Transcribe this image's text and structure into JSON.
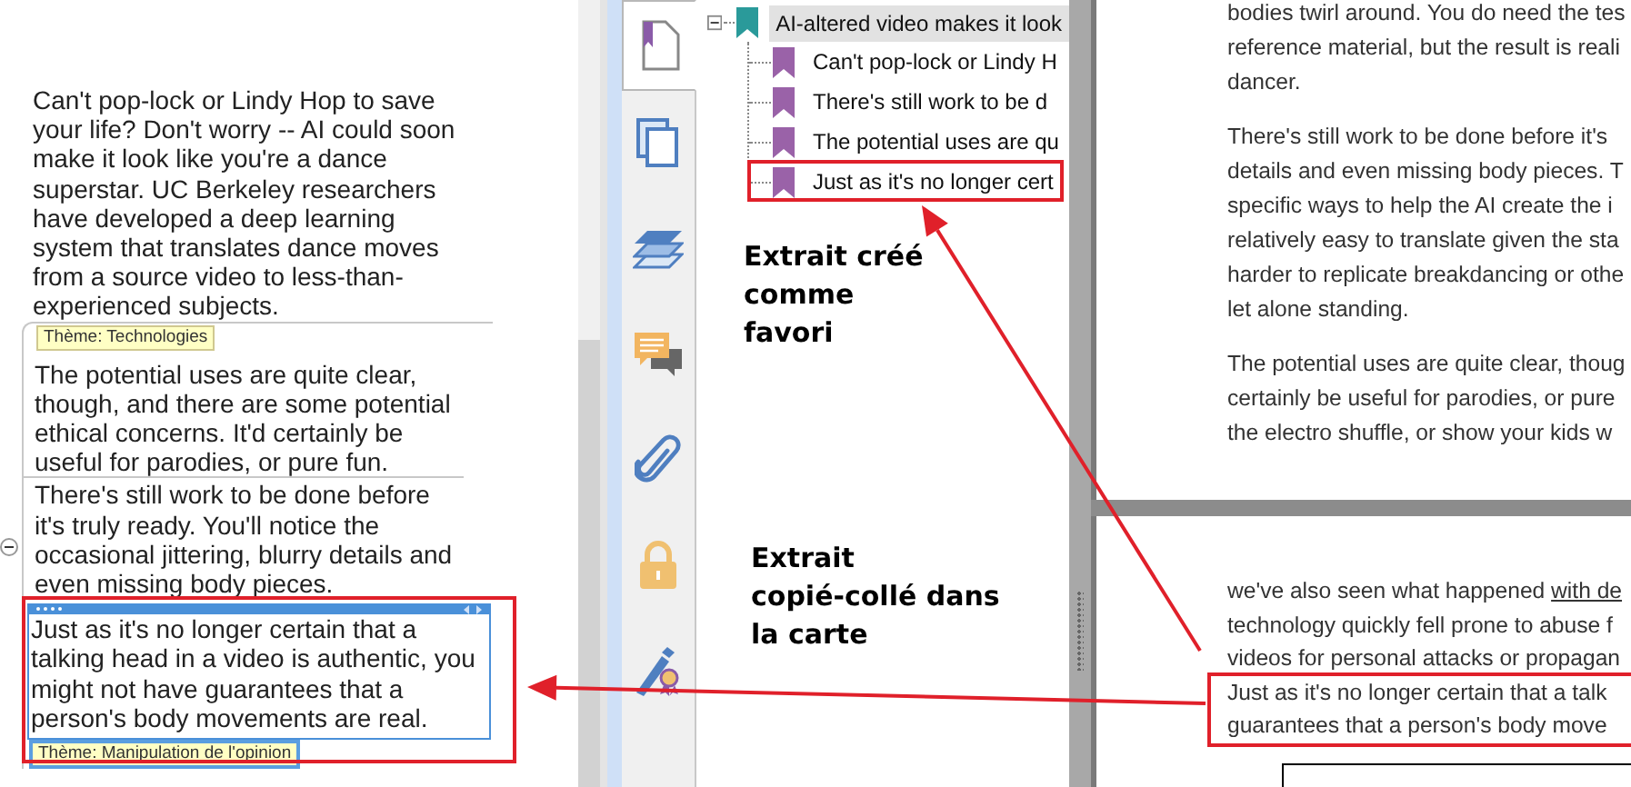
{
  "mind_map": {
    "collapse": {
      "expanded": true
    },
    "items": [
      {
        "kind": "text",
        "text": "Can't pop-lock or Lindy Hop to save your life? Don't worry -- AI could soon make it look like you're a dance superstar. UC Berkeley researchers have developed a deep learning system that translates dance moves from a source video to less-than-experienced subjects.",
        "selected": false
      },
      {
        "kind": "theme",
        "text": "Thème: Technologies",
        "selected": false
      },
      {
        "kind": "text",
        "text": "The potential uses are quite clear, though, and there are some potential ethical concerns. It'd certainly be useful for parodies, or pure fun.",
        "selected": false
      },
      {
        "kind": "text",
        "text": "There's still work to be done before it's truly ready. You'll notice the occasional jittering, blurry details and even missing body pieces.",
        "selected": false
      },
      {
        "kind": "text",
        "text": "Just as it's no longer certain that a talking head in a video is authentic, you might not have guarantees that a person's body movements are real.",
        "selected": true
      },
      {
        "kind": "theme",
        "text": "Thème: Manipulation de l'opinion",
        "selected": true
      }
    ]
  },
  "side_tabs": [
    {
      "kind": "bookmarks",
      "selected": true
    },
    {
      "kind": "pages",
      "selected": false
    },
    {
      "kind": "layers",
      "selected": false
    },
    {
      "kind": "comments",
      "selected": false
    },
    {
      "kind": "attachments",
      "selected": false
    },
    {
      "kind": "security",
      "selected": false
    },
    {
      "kind": "signatures",
      "selected": false
    }
  ],
  "bookmarks": {
    "label": "AI-altered video makes it look",
    "expanded": true,
    "selected": true,
    "children": [
      {
        "label": "Can't pop-lock or Lindy H",
        "selected": false
      },
      {
        "label": "There's still work to be d",
        "selected": false
      },
      {
        "label": "The potential uses are qu",
        "selected": false
      },
      {
        "label": "Just as it's no longer cert",
        "selected": false
      }
    ]
  },
  "annotations": [
    {
      "text": "Extrait créé\ncomme\nfavori"
    },
    {
      "text": "Extrait\ncopié-collé dans\nla carte"
    }
  ],
  "document": {
    "pages": [
      {
        "paragraphs": [
          {
            "lines": [
              {
                "text": "bodies twirl around. You do need the tes"
              },
              {
                "text": "reference material, but the result is reali"
              },
              {
                "text": "dancer."
              }
            ]
          },
          {
            "lines": [
              {
                "text": "There's still work to be done before it's"
              },
              {
                "text": "details and even missing body pieces. T"
              },
              {
                "text": "specific ways to help the AI create the i"
              },
              {
                "text": "relatively easy to translate given the sta"
              },
              {
                "text": "harder to replicate breakdancing or othe"
              },
              {
                "text": "let alone standing."
              }
            ]
          },
          {
            "lines": [
              {
                "text": "The potential uses are quite clear, thoug"
              },
              {
                "text": "certainly be useful for parodies, or pure"
              },
              {
                "text": "the electro shuffle, or show your kids w"
              }
            ]
          }
        ]
      },
      {
        "paragraphs": [
          {
            "lines": [
              {
                "text": "we've also seen what happened ",
                "link": "with de"
              },
              {
                "text": "technology quickly fell prone to abuse f"
              },
              {
                "text": "videos for personal attacks or propagan"
              },
              {
                "text": "Just as it's no longer certain that a talk"
              },
              {
                "text": "guarantees that a person's body move"
              }
            ]
          }
        ]
      }
    ]
  }
}
